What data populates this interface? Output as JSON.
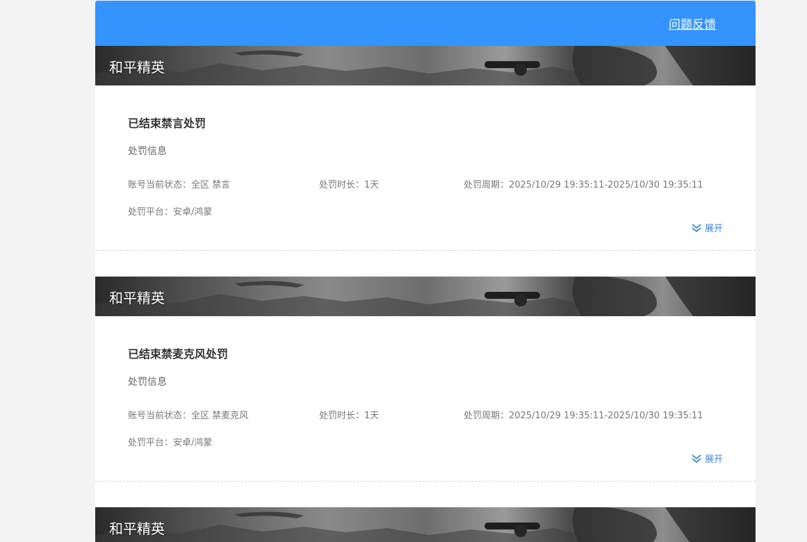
{
  "header": {
    "feedback_label": "问题反馈"
  },
  "colors": {
    "topbar": "#3593fd",
    "link_blue": "#3e87d8"
  },
  "records": [
    {
      "game": "和平精英",
      "title": "已结束禁言处罚",
      "info_heading": "处罚信息",
      "status": "账号当前状态：全区 禁言",
      "duration": "处罚时长：1天",
      "period": "处罚周期：2025/10/29 19:35:11-2025/10/30 19:35:11",
      "platform": "处罚平台：安卓/鸿蒙",
      "expand_label": "展开"
    },
    {
      "game": "和平精英",
      "title": "已结束禁麦克风处罚",
      "info_heading": "处罚信息",
      "status": "账号当前状态：全区 禁麦克风",
      "duration": "处罚时长：1天",
      "period": "处罚周期：2025/10/29 19:35:11-2025/10/30 19:35:11",
      "platform": "处罚平台：安卓/鸿蒙",
      "expand_label": "展开"
    },
    {
      "game": "和平精英"
    }
  ]
}
